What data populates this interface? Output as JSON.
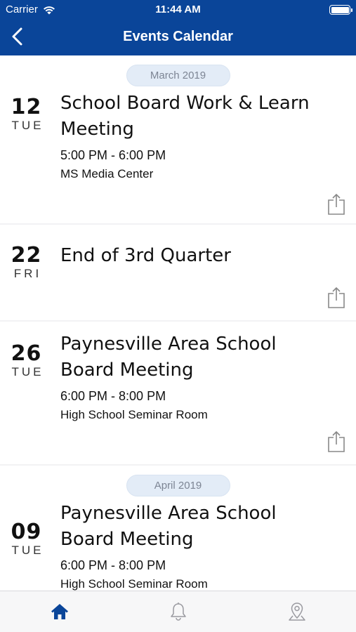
{
  "status_bar": {
    "carrier": "Carrier",
    "time": "11:44 AM"
  },
  "nav": {
    "title": "Events Calendar"
  },
  "months": [
    "March 2019",
    "April 2019"
  ],
  "events": [
    {
      "day": "12",
      "dow": "TUE",
      "title": "School Board Work & Learn Meeting",
      "time": "5:00 PM - 6:00 PM",
      "location": "MS Media Center"
    },
    {
      "day": "22",
      "dow": "FRI",
      "title": "End of 3rd Quarter",
      "time": "",
      "location": ""
    },
    {
      "day": "26",
      "dow": "TUE",
      "title": "Paynesville Area School Board Meeting",
      "time": "6:00 PM - 8:00 PM",
      "location": "High School Seminar Room"
    },
    {
      "day": "09",
      "dow": "TUE",
      "title": "Paynesville Area School Board Meeting",
      "time": "6:00 PM - 8:00 PM",
      "location": "High School Seminar Room"
    }
  ],
  "tabs": [
    {
      "name": "home-icon",
      "active": true
    },
    {
      "name": "bell-icon",
      "active": false
    },
    {
      "name": "map-pin-icon",
      "active": false
    }
  ],
  "colors": {
    "brand": "#0a4599",
    "month_pill": "#e3ecf7",
    "tab_active": "#0a4599",
    "tab_inactive": "#9a9aa0"
  }
}
